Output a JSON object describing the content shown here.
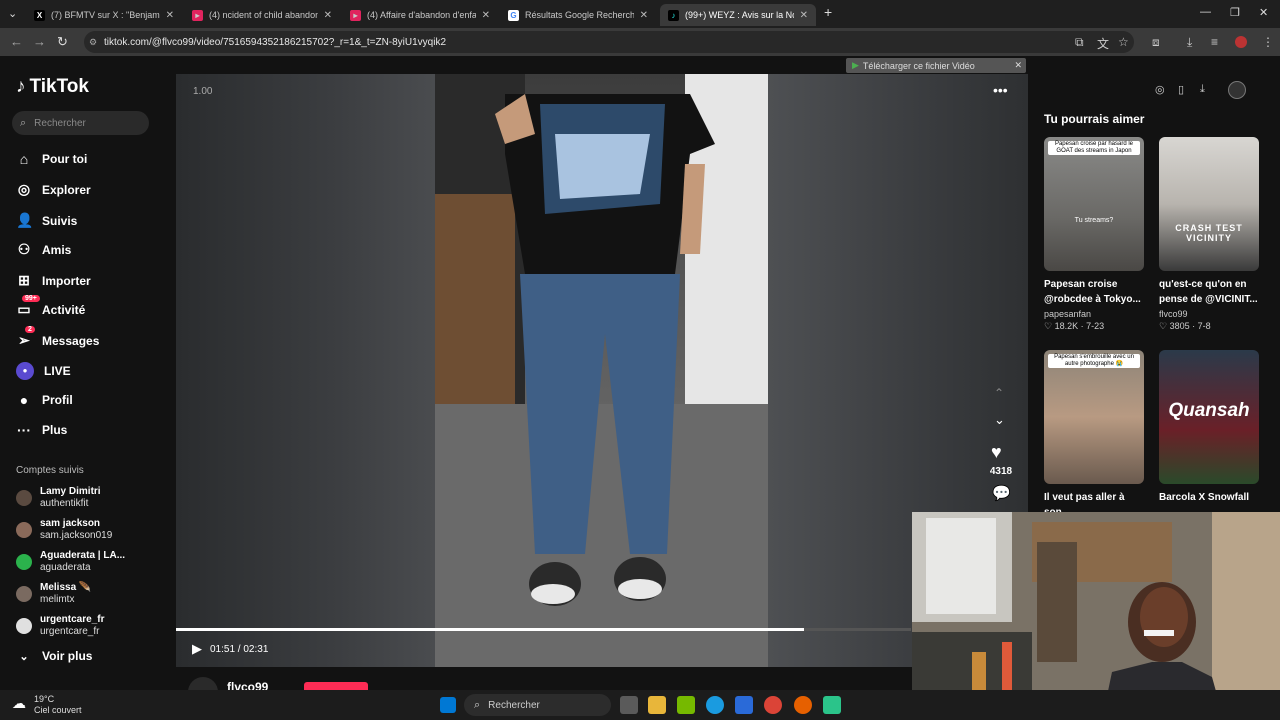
{
  "browser": {
    "tabs": [
      {
        "title": "(7) BFMTV sur X : \"Benjamin Ne",
        "favicon": "x-icon"
      },
      {
        "title": "(4) ncident of child abandonme",
        "favicon": "youtube-icon"
      },
      {
        "title": "(4) Affaire d'abandon d'enfants",
        "favicon": "youtube-icon"
      },
      {
        "title": "Résultats Google Recherche d'i",
        "favicon": "google-icon"
      },
      {
        "title": "(99+) WEYZ : Avis sur la Nouvel",
        "favicon": "tiktok-icon"
      }
    ],
    "url": "tiktok.com/@flvco99/video/7516594352186215702?_r=1&_t=ZN-8yiU1vyqik2"
  },
  "tiktok": {
    "logo": "TikTok",
    "search_placeholder": "Rechercher",
    "nav": [
      {
        "label": "Pour toi",
        "icon": "home-icon"
      },
      {
        "label": "Explorer",
        "icon": "compass-icon"
      },
      {
        "label": "Suivis",
        "icon": "user-follow-icon"
      },
      {
        "label": "Amis",
        "icon": "friends-icon"
      },
      {
        "label": "Importer",
        "icon": "upload-icon"
      },
      {
        "label": "Activité",
        "icon": "inbox-icon",
        "badge": "99+"
      },
      {
        "label": "Messages",
        "icon": "send-icon",
        "badge": "2"
      },
      {
        "label": "LIVE",
        "icon": "live-icon"
      },
      {
        "label": "Profil",
        "icon": "profile-icon"
      },
      {
        "label": "Plus",
        "icon": "more-icon"
      }
    ],
    "followed_title": "Comptes suivis",
    "followed": [
      {
        "name": "Lamy Dimitri",
        "handle": "authentikfit",
        "color": "#5a4a40"
      },
      {
        "name": "sam jackson",
        "handle": "sam.jackson019",
        "color": "#8a6a5a"
      },
      {
        "name": "Aguaderata | LA...",
        "handle": "aguaderata",
        "color": "#2bb24c"
      },
      {
        "name": "Melissa 🪶",
        "handle": "melimtx",
        "color": "#7a6a60"
      },
      {
        "name": "urgentcare_fr",
        "handle": "urgentcare_fr",
        "color": "#e0e0e0"
      }
    ],
    "see_more": "Voir plus",
    "video": {
      "speed": "1.00",
      "time": "01:51 / 02:31",
      "progress": 0.855,
      "likes": "4318",
      "author": "flvco99"
    },
    "download_banner": "Télécharger ce fichier Vidéo",
    "suggest_title": "Tu pourrais aimer",
    "suggestions": [
      {
        "overlay": "Papesan croise par hasard le GOAT des streams in Japon",
        "caption_overlay": "Tu streams?",
        "title": "Papesan croise @robcdee à Tokyo...",
        "user": "papesanfan",
        "likes": "18.2K",
        "date": "7-23"
      },
      {
        "overlay": "CRASH TEST VICINITY",
        "caption_overlay": "",
        "title": "qu'est-ce qu'on en pense de @VICINIT...",
        "user": "flvco99",
        "likes": "3805",
        "date": "7-8"
      },
      {
        "overlay": "Papesan s'embrouille avec un autre photographe 😭",
        "caption_overlay": "",
        "title": "Il veut pas aller à son",
        "user": "",
        "likes": "",
        "date": ""
      },
      {
        "overlay": "Quansah",
        "caption_overlay": "",
        "title": "Barcola X Snowfall",
        "user": "",
        "likes": "",
        "date": ""
      }
    ]
  },
  "taskbar": {
    "weather_temp": "19°C",
    "weather_desc": "Ciel couvert",
    "search": "Rechercher"
  }
}
